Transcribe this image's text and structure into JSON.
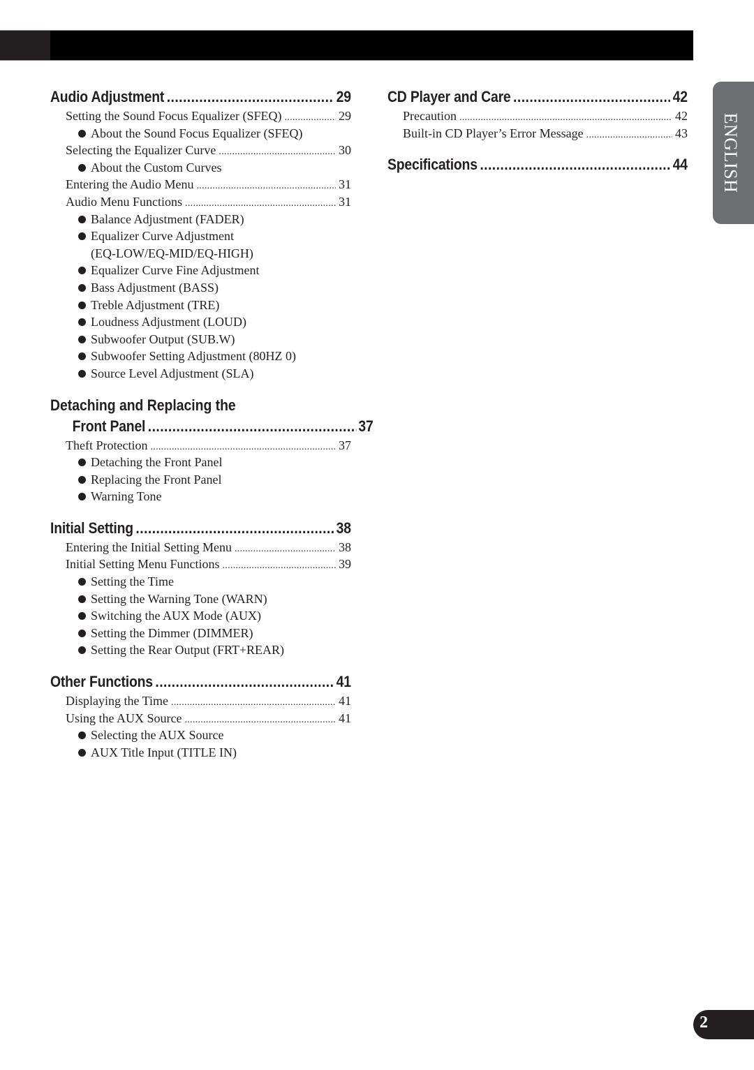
{
  "language_tab": "ENGLISH",
  "page_number": "2",
  "left_column": [
    {
      "title": "Audio Adjustment",
      "page": "29",
      "entries": [
        {
          "type": "item",
          "label": "Setting the Sound Focus Equalizer (SFEQ)",
          "page": "29"
        },
        {
          "type": "bullet",
          "label": "About the Sound Focus Equalizer (SFEQ)"
        },
        {
          "type": "item",
          "label": "Selecting the Equalizer Curve",
          "page": "30"
        },
        {
          "type": "bullet",
          "label": "About the Custom Curves"
        },
        {
          "type": "item",
          "label": "Entering the Audio Menu",
          "page": "31"
        },
        {
          "type": "item",
          "label": "Audio Menu Functions",
          "page": "31"
        },
        {
          "type": "bullet",
          "label": "Balance Adjustment (FADER)"
        },
        {
          "type": "bullet",
          "label": "Equalizer Curve Adjustment"
        },
        {
          "type": "continuation",
          "label": "(EQ-LOW/EQ-MID/EQ-HIGH)"
        },
        {
          "type": "bullet",
          "label": "Equalizer Curve Fine Adjustment"
        },
        {
          "type": "bullet",
          "label": "Bass Adjustment (BASS)"
        },
        {
          "type": "bullet",
          "label": "Treble Adjustment (TRE)"
        },
        {
          "type": "bullet",
          "label": "Loudness Adjustment (LOUD)"
        },
        {
          "type": "bullet",
          "label": "Subwoofer Output (SUB.W)"
        },
        {
          "type": "bullet",
          "label": "Subwoofer Setting Adjustment (80HZ 0)"
        },
        {
          "type": "bullet",
          "label": "Source Level Adjustment (SLA)"
        }
      ]
    },
    {
      "title_line1": "Detaching and Replacing the",
      "title": "Front Panel",
      "page": "37",
      "entries": [
        {
          "type": "item",
          "label": "Theft Protection",
          "page": "37"
        },
        {
          "type": "bullet",
          "label": "Detaching the Front Panel"
        },
        {
          "type": "bullet",
          "label": "Replacing the Front Panel"
        },
        {
          "type": "bullet",
          "label": "Warning Tone"
        }
      ]
    },
    {
      "title": "Initial Setting",
      "page": "38",
      "entries": [
        {
          "type": "item",
          "label": "Entering the Initial Setting Menu",
          "page": "38"
        },
        {
          "type": "item",
          "label": "Initial Setting Menu Functions",
          "page": "39"
        },
        {
          "type": "bullet",
          "label": "Setting the Time"
        },
        {
          "type": "bullet",
          "label": "Setting the Warning Tone (WARN)"
        },
        {
          "type": "bullet",
          "label": "Switching the AUX Mode (AUX)"
        },
        {
          "type": "bullet",
          "label": "Setting the Dimmer (DIMMER)"
        },
        {
          "type": "bullet",
          "label": "Setting the Rear Output (FRT+REAR)"
        }
      ]
    },
    {
      "title": "Other Functions",
      "page": "41",
      "entries": [
        {
          "type": "item",
          "label": "Displaying the Time",
          "page": "41"
        },
        {
          "type": "item",
          "label": "Using the AUX Source",
          "page": "41"
        },
        {
          "type": "bullet",
          "label": "Selecting the AUX Source"
        },
        {
          "type": "bullet",
          "label": "AUX Title Input (TITLE IN)"
        }
      ]
    }
  ],
  "right_column": [
    {
      "title": "CD Player and Care",
      "page": "42",
      "entries": [
        {
          "type": "item",
          "label": "Precaution",
          "page": "42"
        },
        {
          "type": "item",
          "label": "Built-in CD Player’s Error Message",
          "page": "43"
        }
      ]
    },
    {
      "title": "Specifications",
      "page": "44",
      "entries": []
    }
  ]
}
